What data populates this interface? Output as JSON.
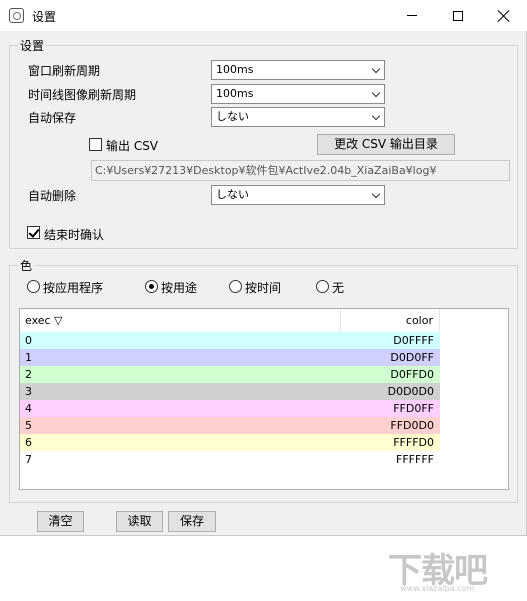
{
  "window": {
    "title": "设置"
  },
  "settings_group": {
    "label": "设置",
    "window_refresh": {
      "label": "窗口刷新周期",
      "value": "100ms"
    },
    "timeline_refresh": {
      "label": "时间线图像刷新周期",
      "value": "100ms"
    },
    "auto_save": {
      "label": "自动保存",
      "value": "しない"
    },
    "output_csv": {
      "label": "输出 CSV",
      "checked": false
    },
    "change_csv_button": "更改 CSV 输出目录",
    "csv_path": "C:¥Users¥27213¥Desktop¥软件包¥ActIve2.04b_XiaZaiBa¥log¥",
    "auto_delete": {
      "label": "自动删除",
      "value": "しない"
    },
    "confirm_on_exit": {
      "label": "结束时确认",
      "checked": true
    }
  },
  "color_group": {
    "label": "色",
    "radio_options": [
      {
        "label": "按应用程序",
        "selected": false
      },
      {
        "label": "按用途",
        "selected": true
      },
      {
        "label": "按时间",
        "selected": false
      },
      {
        "label": "无",
        "selected": false
      }
    ],
    "table": {
      "columns": [
        "exec ▽",
        "color"
      ],
      "rows": [
        {
          "exec": "0",
          "color": "D0FFFF",
          "bg": "#D0FFFF"
        },
        {
          "exec": "1",
          "color": "D0D0FF",
          "bg": "#D0D0FF"
        },
        {
          "exec": "2",
          "color": "D0FFD0",
          "bg": "#D0FFD0"
        },
        {
          "exec": "3",
          "color": "D0D0D0",
          "bg": "#D0D0D0"
        },
        {
          "exec": "4",
          "color": "FFD0FF",
          "bg": "#FFD0FF"
        },
        {
          "exec": "5",
          "color": "FFD0D0",
          "bg": "#FFD0D0"
        },
        {
          "exec": "6",
          "color": "FFFFD0",
          "bg": "#FFFFD0"
        },
        {
          "exec": "7",
          "color": "FFFFFF",
          "bg": "#FFFFFF"
        }
      ]
    },
    "buttons": {
      "clear": "清空",
      "read": "读取",
      "save": "保存"
    }
  },
  "watermark": {
    "main": "下载吧",
    "sub": "www.xiazaiba.com"
  }
}
